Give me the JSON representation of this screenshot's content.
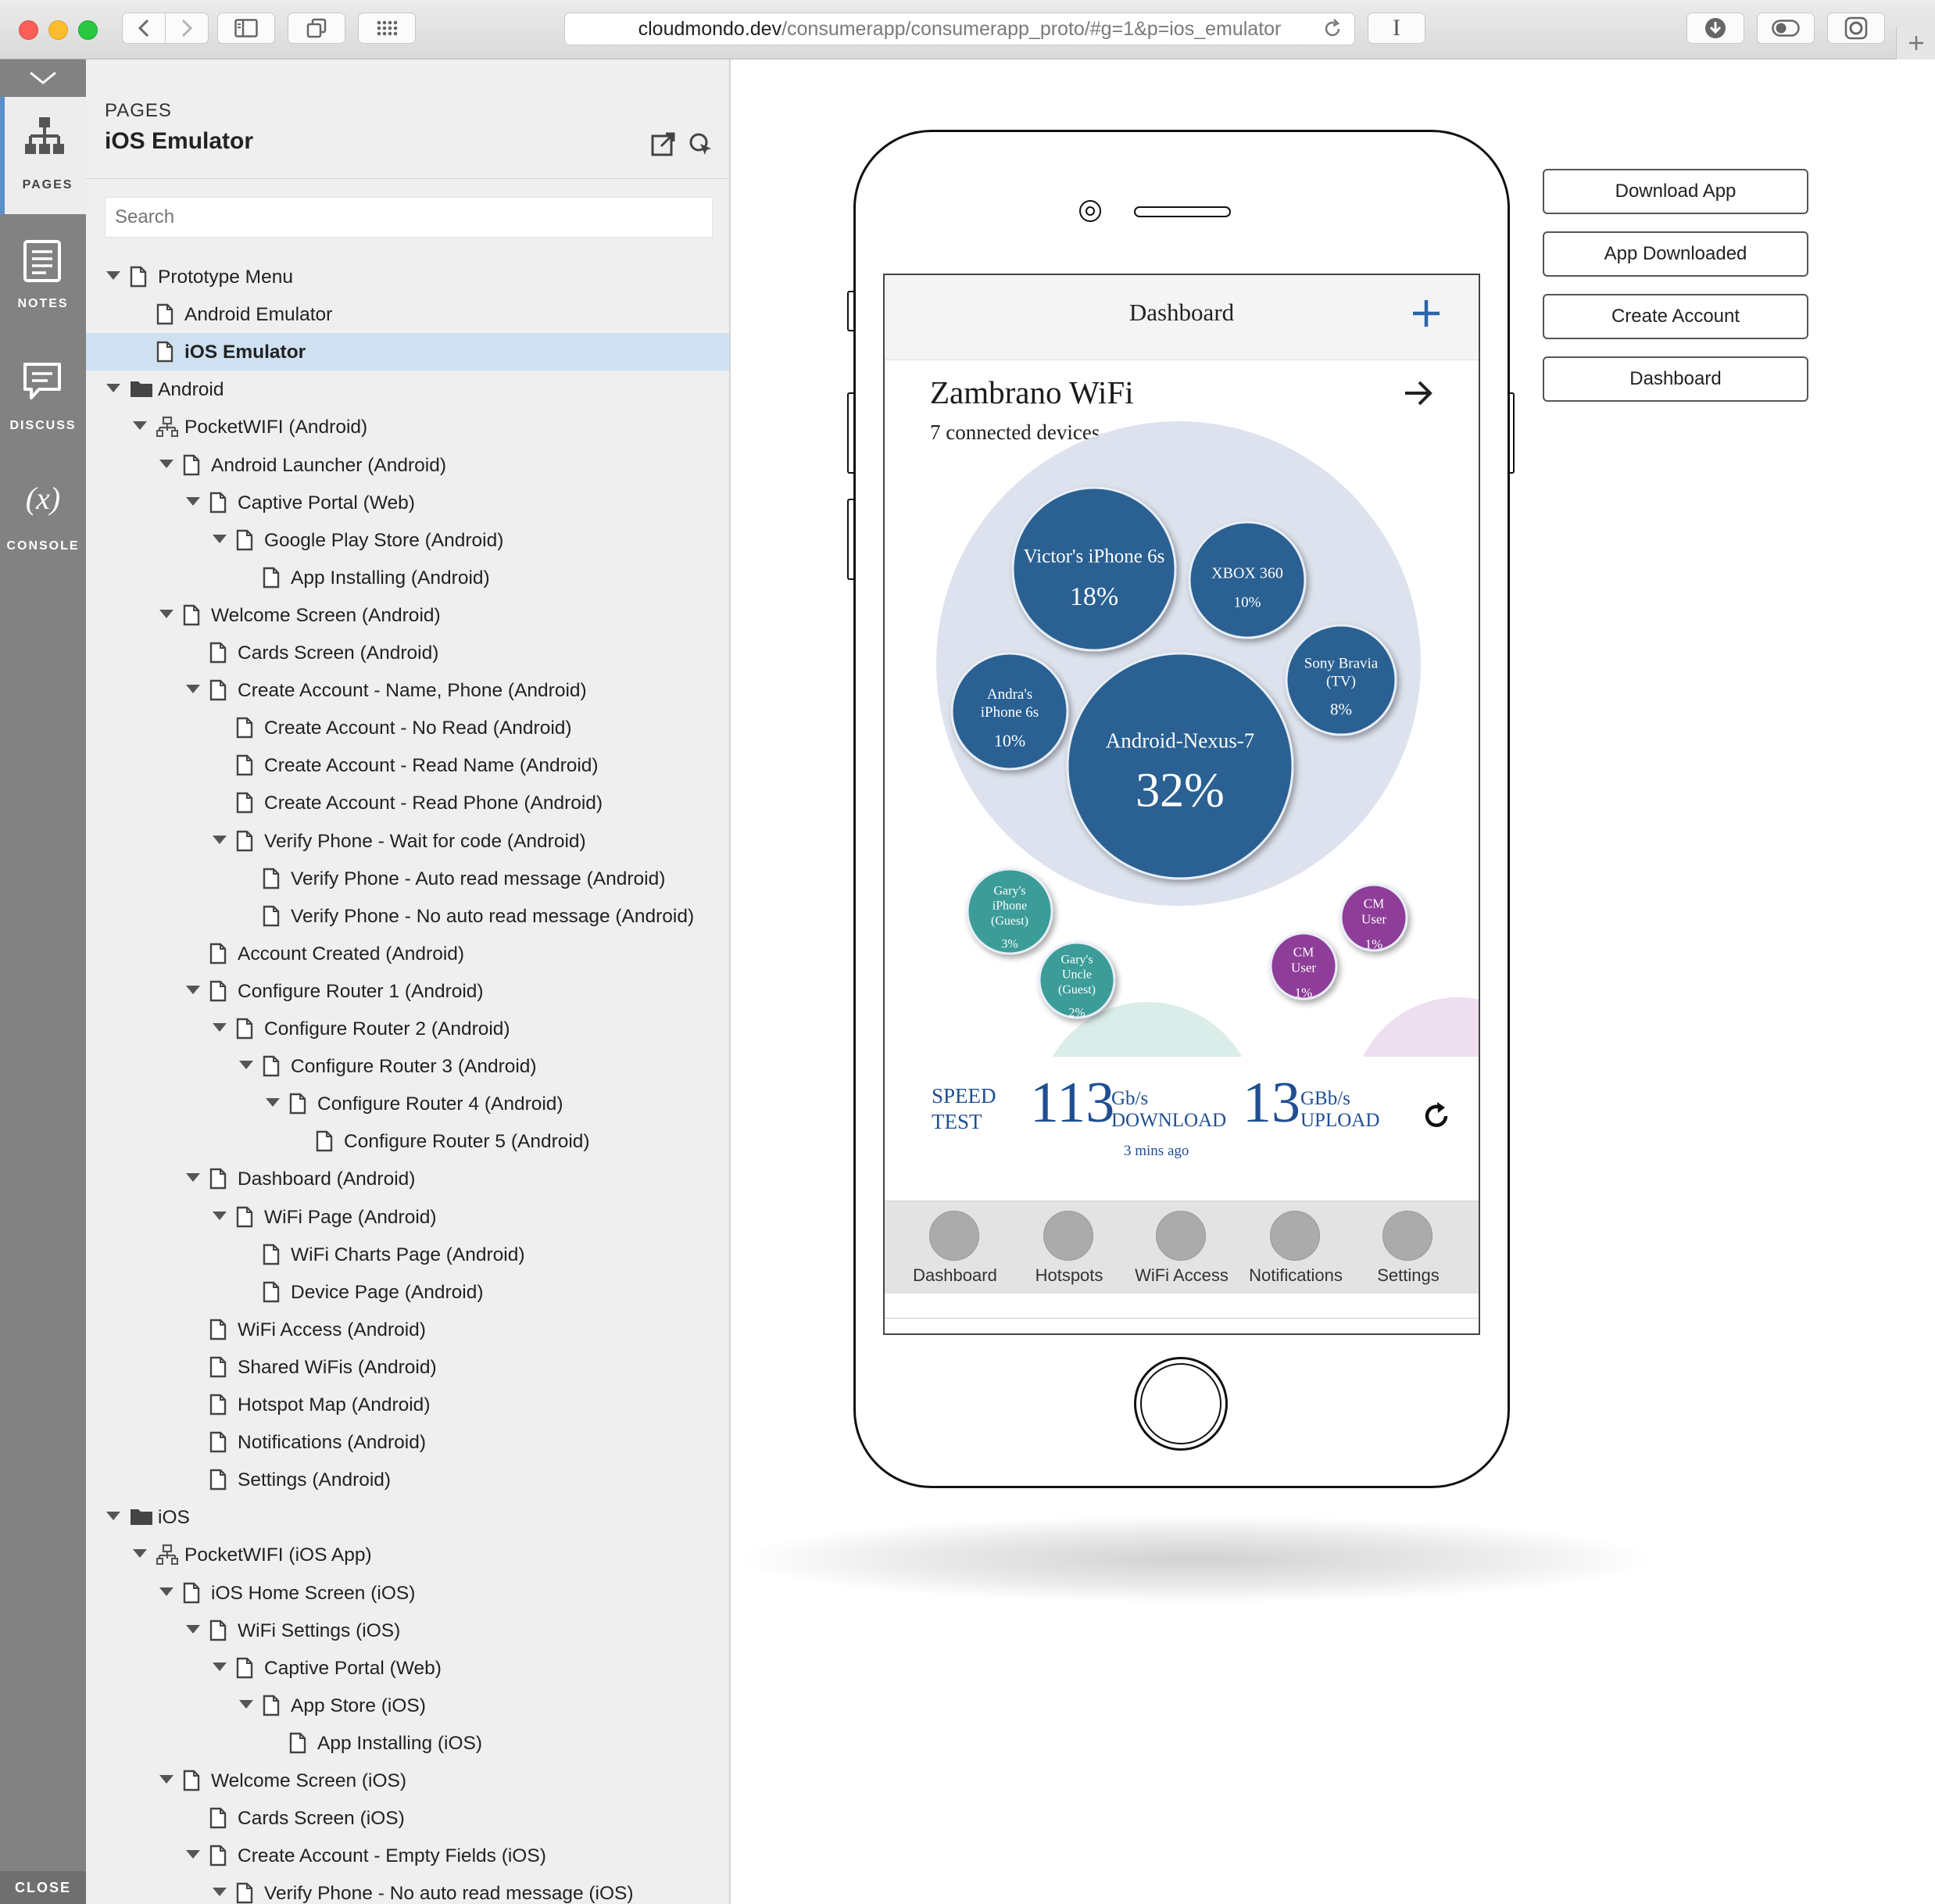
{
  "browser": {
    "url_host": "cloudmondo.dev",
    "url_path": "/consumerapp/consumerapp_proto/#g=1&p=ios_emulator",
    "reader_glyph": "I"
  },
  "rail": {
    "pages_label": "PAGES",
    "notes_label": "NOTES",
    "discuss_label": "DISCUSS",
    "console_label": "CONSOLE",
    "console_glyph": "(x)",
    "close_label": "CLOSE"
  },
  "panel": {
    "caption": "PAGES",
    "title": "iOS Emulator",
    "search_placeholder": "Search",
    "tree": [
      {
        "label": "Prototype Menu",
        "depth": 0,
        "caret": true,
        "icon": "page-icon"
      },
      {
        "label": "Android Emulator",
        "depth": 1,
        "caret": false,
        "icon": "page-icon"
      },
      {
        "label": "iOS Emulator",
        "depth": 1,
        "caret": false,
        "icon": "page-icon",
        "selected": true
      },
      {
        "label": "Android",
        "depth": 0,
        "caret": true,
        "icon": "folder-icon"
      },
      {
        "label": "PocketWIFI (Android)",
        "depth": 1,
        "caret": true,
        "icon": "flow-icon"
      },
      {
        "label": "Android Launcher (Android)",
        "depth": 2,
        "caret": true,
        "icon": "page-icon"
      },
      {
        "label": "Captive Portal (Web)",
        "depth": 3,
        "caret": true,
        "icon": "page-icon"
      },
      {
        "label": "Google Play Store (Android)",
        "depth": 4,
        "caret": true,
        "icon": "page-icon"
      },
      {
        "label": "App Installing (Android)",
        "depth": 5,
        "caret": false,
        "icon": "page-icon"
      },
      {
        "label": "Welcome Screen (Android)",
        "depth": 2,
        "caret": true,
        "icon": "page-icon"
      },
      {
        "label": "Cards Screen (Android)",
        "depth": 3,
        "caret": false,
        "icon": "page-icon"
      },
      {
        "label": "Create Account - Name, Phone (Android)",
        "depth": 3,
        "caret": true,
        "icon": "page-icon"
      },
      {
        "label": "Create Account - No Read (Android)",
        "depth": 4,
        "caret": false,
        "icon": "page-icon"
      },
      {
        "label": "Create Account - Read Name (Android)",
        "depth": 4,
        "caret": false,
        "icon": "page-icon"
      },
      {
        "label": "Create Account - Read Phone (Android)",
        "depth": 4,
        "caret": false,
        "icon": "page-icon"
      },
      {
        "label": "Verify Phone - Wait for code (Android)",
        "depth": 4,
        "caret": true,
        "icon": "page-icon"
      },
      {
        "label": "Verify Phone - Auto read message (Android)",
        "depth": 5,
        "caret": false,
        "icon": "page-icon"
      },
      {
        "label": "Verify Phone - No auto read message (Android)",
        "depth": 5,
        "caret": false,
        "icon": "page-icon"
      },
      {
        "label": "Account Created (Android)",
        "depth": 3,
        "caret": false,
        "icon": "page-icon"
      },
      {
        "label": "Configure Router 1 (Android)",
        "depth": 3,
        "caret": true,
        "icon": "page-icon"
      },
      {
        "label": "Configure Router 2 (Android)",
        "depth": 4,
        "caret": true,
        "icon": "page-icon"
      },
      {
        "label": "Configure Router 3 (Android)",
        "depth": 5,
        "caret": true,
        "icon": "page-icon"
      },
      {
        "label": "Configure Router 4 (Android)",
        "depth": 6,
        "caret": true,
        "icon": "page-icon"
      },
      {
        "label": "Configure Router 5 (Android)",
        "depth": 7,
        "caret": false,
        "icon": "page-icon"
      },
      {
        "label": "Dashboard (Android)",
        "depth": 3,
        "caret": true,
        "icon": "page-icon"
      },
      {
        "label": "WiFi Page (Android)",
        "depth": 4,
        "caret": true,
        "icon": "page-icon"
      },
      {
        "label": "WiFi Charts Page (Android)",
        "depth": 5,
        "caret": false,
        "icon": "page-icon"
      },
      {
        "label": "Device Page (Android)",
        "depth": 5,
        "caret": false,
        "icon": "page-icon"
      },
      {
        "label": "WiFi Access (Android)",
        "depth": 3,
        "caret": false,
        "icon": "page-icon"
      },
      {
        "label": "Shared WiFis (Android)",
        "depth": 3,
        "caret": false,
        "icon": "page-icon"
      },
      {
        "label": "Hotspot Map (Android)",
        "depth": 3,
        "caret": false,
        "icon": "page-icon"
      },
      {
        "label": "Notifications (Android)",
        "depth": 3,
        "caret": false,
        "icon": "page-icon"
      },
      {
        "label": "Settings (Android)",
        "depth": 3,
        "caret": false,
        "icon": "page-icon"
      },
      {
        "label": "iOS",
        "depth": 0,
        "caret": true,
        "icon": "folder-icon"
      },
      {
        "label": "PocketWIFI (iOS App)",
        "depth": 1,
        "caret": true,
        "icon": "flow-icon"
      },
      {
        "label": "iOS Home Screen (iOS)",
        "depth": 2,
        "caret": true,
        "icon": "page-icon"
      },
      {
        "label": "WiFi Settings (iOS)",
        "depth": 3,
        "caret": true,
        "icon": "page-icon"
      },
      {
        "label": "Captive Portal (Web)",
        "depth": 4,
        "caret": true,
        "icon": "page-icon"
      },
      {
        "label": "App Store (iOS)",
        "depth": 5,
        "caret": true,
        "icon": "page-icon"
      },
      {
        "label": "App Installing (iOS)",
        "depth": 6,
        "caret": false,
        "icon": "page-icon"
      },
      {
        "label": "Welcome Screen (iOS)",
        "depth": 2,
        "caret": true,
        "icon": "page-icon"
      },
      {
        "label": "Cards Screen (iOS)",
        "depth": 3,
        "caret": false,
        "icon": "page-icon"
      },
      {
        "label": "Create Account - Empty Fields (iOS)",
        "depth": 3,
        "caret": true,
        "icon": "page-icon"
      },
      {
        "label": "Verify Phone - No auto read message (iOS)",
        "depth": 4,
        "caret": true,
        "icon": "page-icon"
      }
    ]
  },
  "phone": {
    "header_title": "Dashboard",
    "wifi_name": "Zambrano WiFi",
    "wifi_subtitle": "7 connected devices",
    "colors": {
      "main_group": "#d9dfec",
      "main_bubble": "#2a6192",
      "guest_group": "#d6ebe7",
      "guest_bubble": "#3a9c98",
      "cm_group": "#ecdcee",
      "cm_bubble": "#8e3e98"
    },
    "devices": [
      {
        "lines": [
          "Victor's iPhone 6s"
        ],
        "pct": "18%",
        "group": "main"
      },
      {
        "lines": [
          "XBOX 360"
        ],
        "pct": "10%",
        "group": "main"
      },
      {
        "lines": [
          "Sony Bravia",
          "(TV)"
        ],
        "pct": "8%",
        "group": "main"
      },
      {
        "lines": [
          "Andra's",
          "iPhone 6s"
        ],
        "pct": "10%",
        "group": "main"
      },
      {
        "lines": [
          "Android-Nexus-7"
        ],
        "pct": "32%",
        "group": "main"
      },
      {
        "lines": [
          "Gary's",
          "iPhone",
          "(Guest)"
        ],
        "pct": "3%",
        "group": "guest"
      },
      {
        "lines": [
          "Gary's",
          "Uncle",
          "(Guest)"
        ],
        "pct": "2%",
        "group": "guest"
      },
      {
        "lines": [
          "CM",
          "User"
        ],
        "pct": "1%",
        "group": "cm"
      },
      {
        "lines": [
          "CM",
          "User"
        ],
        "pct": "1%",
        "group": "cm"
      }
    ],
    "speed": {
      "label_line1": "SPEED",
      "label_line2": "TEST",
      "download_value": "113",
      "download_unit": "Gb/s",
      "download_label": "DOWNLOAD",
      "upload_value": "13",
      "upload_unit": "GBb/s",
      "upload_label": "UPLOAD",
      "updated": "3 mins ago"
    },
    "tabs": [
      "Dashboard",
      "Hotspots",
      "WiFi Access",
      "Notifications",
      "Settings"
    ]
  },
  "nav_buttons": {
    "download_app": "Download App",
    "app_downloaded": "App Downloaded",
    "create_account": "Create Account",
    "dashboard": "Dashboard"
  }
}
